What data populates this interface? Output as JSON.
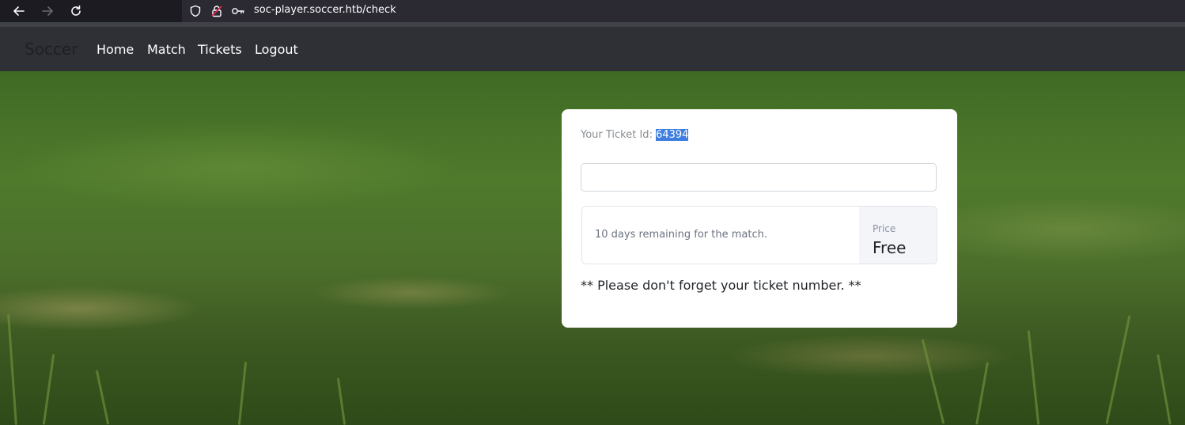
{
  "browser": {
    "url": "soc-player.soccer.htb/check"
  },
  "navbar": {
    "brand": "Soccer",
    "links": [
      "Home",
      "Match",
      "Tickets",
      "Logout"
    ]
  },
  "ticket": {
    "id_label": "Your Ticket Id:",
    "id_value": "64394",
    "input_value": "",
    "remaining_text": "10 days remaining for the match.",
    "price_label": "Price",
    "price_value": "Free",
    "reminder": "** Please don't forget your ticket number. **"
  }
}
